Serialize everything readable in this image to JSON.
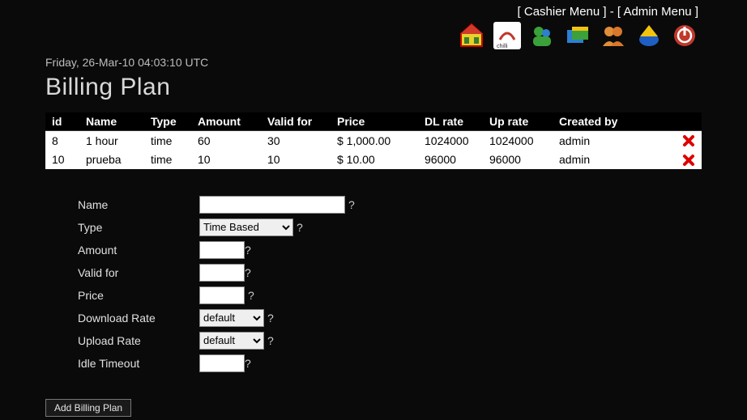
{
  "topbar": {
    "cashier": "Cashier Menu",
    "admin": "Admin Menu"
  },
  "icons": [
    "home-icon",
    "chillispot-icon",
    "users-icon",
    "windows-icon",
    "people-icon",
    "home2-icon",
    "power-icon"
  ],
  "timestamp": "Friday, 26-Mar-10 04:03:10 UTC",
  "page_title": "Billing Plan",
  "table": {
    "headers": [
      "id",
      "Name",
      "Type",
      "Amount",
      "Valid for",
      "Price",
      "DL rate",
      "Up rate",
      "Created by",
      ""
    ],
    "rows": [
      {
        "id": "8",
        "name": "1 hour",
        "type": "time",
        "amount": "60",
        "valid": "30",
        "price": "$ 1,000.00",
        "dl": "1024000",
        "up": "1024000",
        "by": "admin"
      },
      {
        "id": "10",
        "name": "prueba",
        "type": "time",
        "amount": "10",
        "valid": "10",
        "price": "$ 10.00",
        "dl": "96000",
        "up": "96000",
        "by": "admin"
      }
    ]
  },
  "form": {
    "labels": {
      "name": "Name",
      "type": "Type",
      "amount": "Amount",
      "valid": "Valid for",
      "price": "Price",
      "dl": "Download Rate",
      "ul": "Upload Rate",
      "idle": "Idle Timeout"
    },
    "type_options": [
      "Time Based"
    ],
    "type_selected": "Time Based",
    "rate_options": [
      "default"
    ],
    "dl_selected": "default",
    "ul_selected": "default",
    "values": {
      "name": "",
      "amount": "",
      "valid": "",
      "price": "",
      "idle": ""
    },
    "help": "?",
    "submit": "Add Billing Plan"
  }
}
